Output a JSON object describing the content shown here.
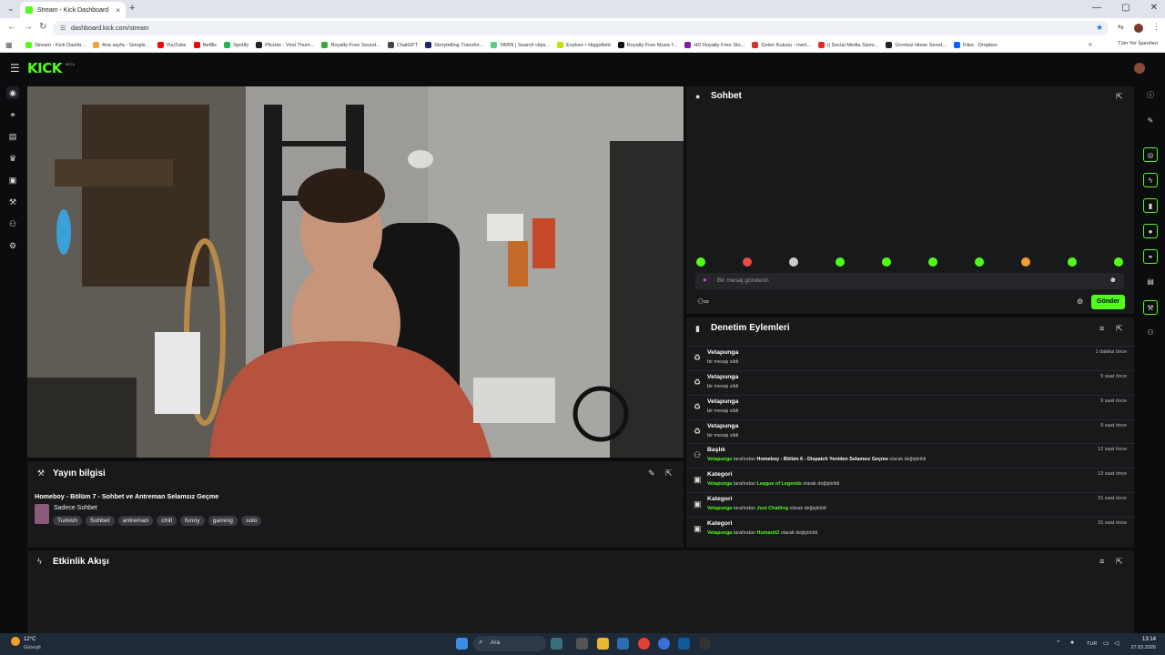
{
  "browser": {
    "tab_title": "Stream - Kick Dashboard",
    "tab_close": "×",
    "new_tab": "+",
    "url": "dashboard.kick.com/stream",
    "bookmarks": [
      {
        "label": "Stream - Kick Dashb...",
        "color": "#53fc18"
      },
      {
        "label": "Ana sayfa - Google...",
        "color": "#f2a33a"
      },
      {
        "label": "YouTube",
        "color": "#ff0000"
      },
      {
        "label": "Netflix",
        "color": "#e50914"
      },
      {
        "label": "Spotify",
        "color": "#1db954"
      },
      {
        "label": "Pikzels - Viral Thum...",
        "color": "#222222"
      },
      {
        "label": "Royalty-Free Sound...",
        "color": "#3aa63a"
      },
      {
        "label": "ChatGPT",
        "color": "#444444"
      },
      {
        "label": "Storytelling Transfor...",
        "color": "#222266"
      },
      {
        "label": "YARN | Search clips...",
        "color": "#55cc88"
      },
      {
        "label": "Explore • Higgsfield",
        "color": "#c8e000"
      },
      {
        "label": "Royalty Free Music f...",
        "color": "#111111"
      },
      {
        "label": "HD Royalty Free Sto...",
        "color": "#7a1fa2"
      },
      {
        "label": "Gelen Kutusu - mert...",
        "color": "#d93025"
      },
      {
        "label": "|| Social Media Sizes...",
        "color": "#d93025"
      },
      {
        "label": "Ücretsiz Hisse Senet...",
        "color": "#222222"
      },
      {
        "label": "Files - Dropbox",
        "color": "#0061fe"
      }
    ],
    "all_bookmarks": "Tüm Yer İşaretleri"
  },
  "header": {
    "logo": "KICK",
    "logo_badge": "BETA"
  },
  "stream_info": {
    "panel_title": "Yayın bilgisi",
    "title": "Homeboy - Bölüm 7 - Sohbet ve Antreman Selamsız Geçme",
    "category": "Sadece Sohbet",
    "tags": [
      "Turkish",
      "Sohbet",
      "antreman",
      "chill",
      "funny",
      "gaming",
      "solo"
    ]
  },
  "activity": {
    "panel_title": "Etkinlik Akışı"
  },
  "chat": {
    "panel_title": "Sohbet",
    "placeholder": "Bir mesaj gönderin",
    "send_label": "Gönder",
    "emote_colors": [
      "#53fc18",
      "#e74c3c",
      "#cccccc",
      "#53fc18",
      "#53fc18",
      "#53fc18",
      "#53fc18",
      "#f0a030",
      "#53fc18",
      "#53fc18"
    ]
  },
  "mod_actions": {
    "panel_title": "Denetim Eylemleri",
    "rows": [
      {
        "icon": "trash-icon",
        "user": "Vetapunga",
        "text": "bir mesajı sildi",
        "time": "1 dakika önce"
      },
      {
        "icon": "trash-icon",
        "user": "Vetapunga",
        "text": "bir mesajı sildi",
        "time": "9 saat önce"
      },
      {
        "icon": "trash-icon",
        "user": "Vetapunga",
        "text": "bir mesajı sildi",
        "time": "9 saat önce"
      },
      {
        "icon": "trash-icon",
        "user": "Vetapunga",
        "text": "bir mesajı sildi",
        "time": "9 saat önce"
      },
      {
        "icon": "users-icon",
        "user": "Başlık",
        "by": "Vetapunga",
        "mid": "tarafından",
        "value": "Homeboy - Bölüm 6 - Dispatch Yeniden Selamsız Geçme",
        "end": "olarak değiştirildi",
        "time": "12 saat önce"
      },
      {
        "icon": "category-icon",
        "user": "Kategori",
        "by": "Vetapunga",
        "mid": "tarafından",
        "value": "League of Legends",
        "end": "olarak değiştirildi",
        "time": "13 saat önce"
      },
      {
        "icon": "category-icon",
        "user": "Kategori",
        "by": "Vetapunga",
        "mid": "tarafından",
        "value": "Just Chatting",
        "end": "olarak değiştirildi",
        "time": "15 saat önce"
      },
      {
        "icon": "category-icon",
        "user": "Kategori",
        "by": "Vetapunga",
        "mid": "tarafından",
        "value": "HumanitZ",
        "end": "olarak değiştirildi",
        "time": "15 saat önce"
      }
    ]
  },
  "taskbar": {
    "weather_temp": "12°C",
    "weather_desc": "Güneşli",
    "search_label": "Ara",
    "lang": "TUR",
    "time": "13:14",
    "date": "27.03.2026"
  }
}
